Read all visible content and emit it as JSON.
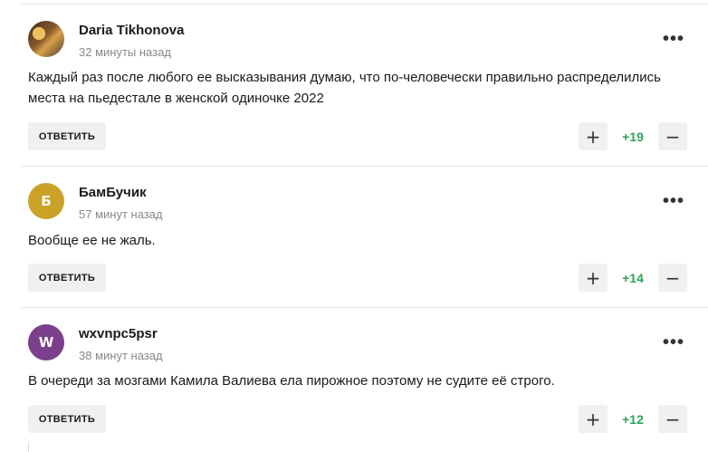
{
  "comments": [
    {
      "author": "Daria Tikhonova",
      "time": "32 минуты назад",
      "text": "Каждый раз после любого ее высказывания думаю, что по-человечески правильно распределились места на пьедестале в женской одиночке 2022",
      "avatar_type": "photo",
      "avatar_letter": "",
      "avatar_color": "#8a5a2a",
      "score": "+19"
    },
    {
      "author": "БамБучик",
      "time": "57 минут назад",
      "text": "Вообще ее не жаль.",
      "avatar_type": "letter",
      "avatar_letter": "Б",
      "avatar_color": "#c9a227",
      "score": "+14"
    },
    {
      "author": "wxvnpc5psr",
      "time": "38 минут назад",
      "text": "В очереди за мозгами Камила Валиева ела пирожное поэтому не судите её строго.",
      "avatar_type": "letter",
      "avatar_letter": "W",
      "avatar_color": "#7b3f8c",
      "score": "+12"
    }
  ],
  "labels": {
    "reply": "ОТВЕТИТЬ",
    "more": "•••",
    "plus": "+",
    "minus": "−"
  },
  "colors": {
    "score_positive": "#2fa35a",
    "button_bg": "#f0f0f0"
  }
}
